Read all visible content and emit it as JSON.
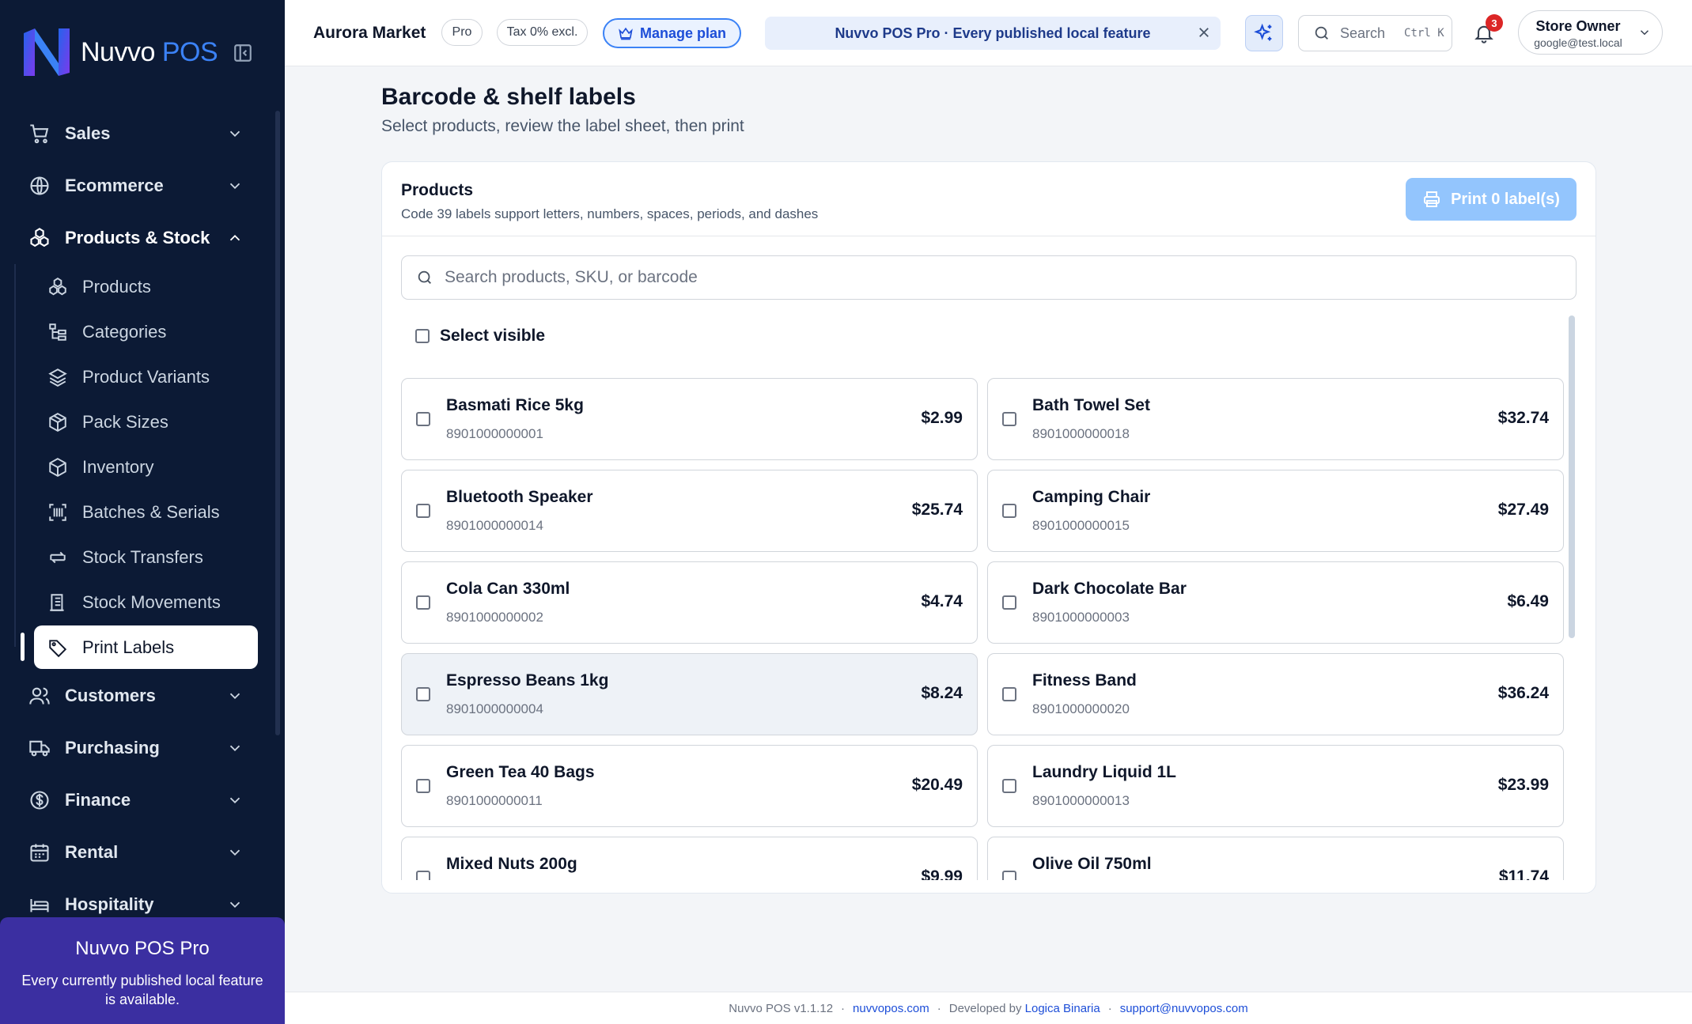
{
  "sidebar": {
    "logo": {
      "brand": "Nuvvo",
      "suffix": "POS"
    },
    "nav": [
      {
        "label": "Sales",
        "icon": "cart-icon"
      },
      {
        "label": "Ecommerce",
        "icon": "globe-icon"
      },
      {
        "label": "Products & Stock",
        "icon": "boxes-icon"
      }
    ],
    "sub": [
      {
        "label": "Products",
        "icon": "boxes-icon"
      },
      {
        "label": "Categories",
        "icon": "tree-icon"
      },
      {
        "label": "Product Variants",
        "icon": "layers-icon"
      },
      {
        "label": "Pack Sizes",
        "icon": "package-icon"
      },
      {
        "label": "Inventory",
        "icon": "cube-icon"
      },
      {
        "label": "Batches & Serials",
        "icon": "scan-barcode-icon"
      },
      {
        "label": "Stock Transfers",
        "icon": "transfer-icon"
      },
      {
        "label": "Stock Movements",
        "icon": "ledger-icon"
      },
      {
        "label": "Print Labels",
        "icon": "tag-icon"
      }
    ],
    "nav2": [
      {
        "label": "Customers",
        "icon": "users-icon"
      },
      {
        "label": "Purchasing",
        "icon": "truck-icon"
      },
      {
        "label": "Finance",
        "icon": "dollar-icon"
      },
      {
        "label": "Rental",
        "icon": "calendar-icon"
      },
      {
        "label": "Hospitality",
        "icon": "bed-icon"
      }
    ],
    "promo": {
      "title": "Nuvvo POS Pro",
      "desc": "Every currently published local feature is available."
    }
  },
  "header": {
    "store": "Aurora Market",
    "plan_badge": "Pro",
    "tax_badge": "Tax 0% excl.",
    "manage_plan": "Manage plan",
    "banner": "Nuvvo POS Pro · Every published local feature",
    "search_label": "Search",
    "search_shortcut": "Ctrl K",
    "notifications": "3",
    "user_name": "Store Owner",
    "user_email": "google@test.local"
  },
  "main": {
    "title": "Barcode & shelf labels",
    "subtitle": "Select products, review the label sheet, then print",
    "card_title": "Products",
    "card_desc": "Code 39 labels support letters, numbers, spaces, periods, and dashes",
    "print_button": "Print 0 label(s)",
    "search_placeholder": "Search products, SKU, or barcode",
    "select_visible": "Select visible",
    "products": [
      {
        "name": "Basmati Rice 5kg",
        "barcode": "8901000000001",
        "price": "$2.99"
      },
      {
        "name": "Bath Towel Set",
        "barcode": "8901000000018",
        "price": "$32.74"
      },
      {
        "name": "Bluetooth Speaker",
        "barcode": "8901000000014",
        "price": "$25.74"
      },
      {
        "name": "Camping Chair",
        "barcode": "8901000000015",
        "price": "$27.49"
      },
      {
        "name": "Cola Can 330ml",
        "barcode": "8901000000002",
        "price": "$4.74"
      },
      {
        "name": "Dark Chocolate Bar",
        "barcode": "8901000000003",
        "price": "$6.49"
      },
      {
        "name": "Espresso Beans 1kg",
        "barcode": "8901000000004",
        "price": "$8.24"
      },
      {
        "name": "Fitness Band",
        "barcode": "8901000000020",
        "price": "$36.24"
      },
      {
        "name": "Green Tea 40 Bags",
        "barcode": "8901000000011",
        "price": "$20.49"
      },
      {
        "name": "Laundry Liquid 1L",
        "barcode": "8901000000013",
        "price": "$23.99"
      },
      {
        "name": "Mixed Nuts 200g",
        "barcode": "",
        "price": "$9.99"
      },
      {
        "name": "Olive Oil 750ml",
        "barcode": "",
        "price": "$11.74"
      }
    ]
  },
  "footer": {
    "version": "Nuvvo POS v1.1.12",
    "site": "nuvvopos.com",
    "dev_prefix": "Developed by",
    "dev": "Logica Binaria",
    "email": "support@nuvvopos.com"
  },
  "colors": {
    "sidebar_bg": "#0c1a35",
    "accent": "#3b82f6",
    "promo_bg": "#3b2fa1",
    "badge_red": "#dc2626",
    "print_button_disabled": "#93c5fd"
  }
}
